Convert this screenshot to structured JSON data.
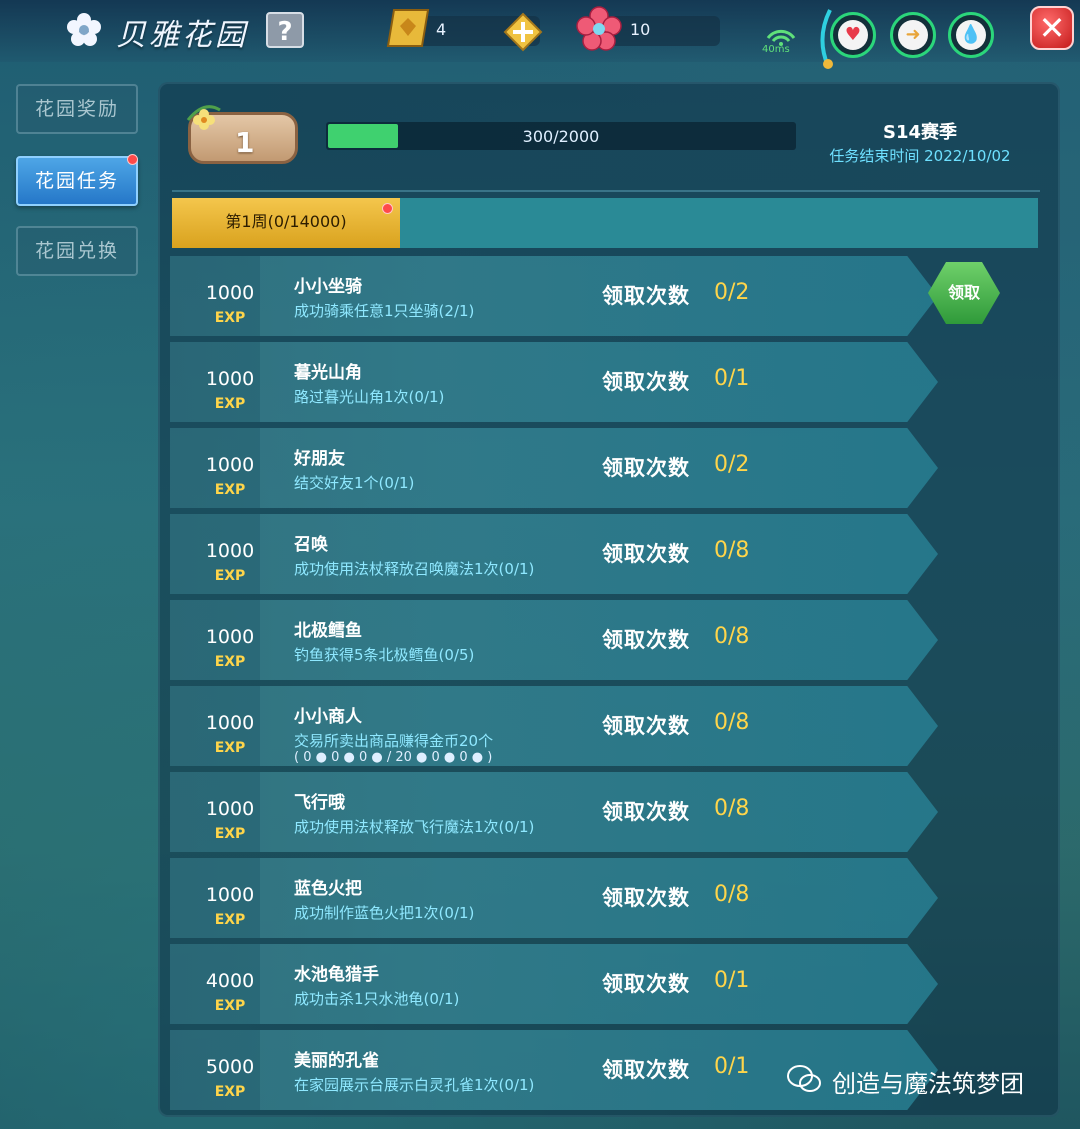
{
  "header": {
    "title": "贝雅花园",
    "help_label": "?",
    "gold_count": "4",
    "flower_count": "10",
    "ping": "40ms",
    "close_label": "✕"
  },
  "sidebar": {
    "items": [
      {
        "label": "花园奖励"
      },
      {
        "label": "花园任务"
      },
      {
        "label": "花园兑换"
      }
    ]
  },
  "level": {
    "value": "1",
    "progress_text": "300/2000",
    "progress_fraction": 0.15
  },
  "season": {
    "title": "S14赛季",
    "end_text": "任务结束时间 2022/10/02"
  },
  "week_tab": {
    "label": "第1周(0/14000)"
  },
  "claim_label": "领取次数",
  "claim_button": "领取",
  "exp_label": "EXP",
  "tasks": [
    {
      "exp": "1000",
      "name": "小小坐骑",
      "desc": "成功骑乘任意1只坐骑(2/1)",
      "count": "0/2"
    },
    {
      "exp": "1000",
      "name": "暮光山角",
      "desc": "路过暮光山角1次(0/1)",
      "count": "0/1"
    },
    {
      "exp": "1000",
      "name": "好朋友",
      "desc": "结交好友1个(0/1)",
      "count": "0/2"
    },
    {
      "exp": "1000",
      "name": "召唤",
      "desc": "成功使用法杖释放召唤魔法1次(0/1)",
      "count": "0/8"
    },
    {
      "exp": "1000",
      "name": "北极鳕鱼",
      "desc": "钓鱼获得5条北极鳕鱼(0/5)",
      "count": "0/8"
    },
    {
      "exp": "1000",
      "name": "小小商人",
      "desc": "交易所卖出商品赚得金币20个",
      "coins": "( 0 ● 0 ● 0 ● / 20 ● 0 ● 0 ● )",
      "count": "0/8"
    },
    {
      "exp": "1000",
      "name": "飞行哦",
      "desc": "成功使用法杖释放飞行魔法1次(0/1)",
      "count": "0/8"
    },
    {
      "exp": "1000",
      "name": "蓝色火把",
      "desc": "成功制作蓝色火把1次(0/1)",
      "count": "0/8"
    },
    {
      "exp": "4000",
      "name": "水池龟猎手",
      "desc": "成功击杀1只水池龟(0/1)",
      "count": "0/1"
    },
    {
      "exp": "5000",
      "name": "美丽的孔雀",
      "desc": "在家园展示台展示白灵孔雀1次(0/1)",
      "count": "0/1"
    }
  ],
  "watermark": "创造与魔法筑梦团",
  "colors": {
    "accent_gold": "#ffd54a",
    "progress_green": "#3fd16f",
    "desc_cyan": "#8fe8ff"
  }
}
